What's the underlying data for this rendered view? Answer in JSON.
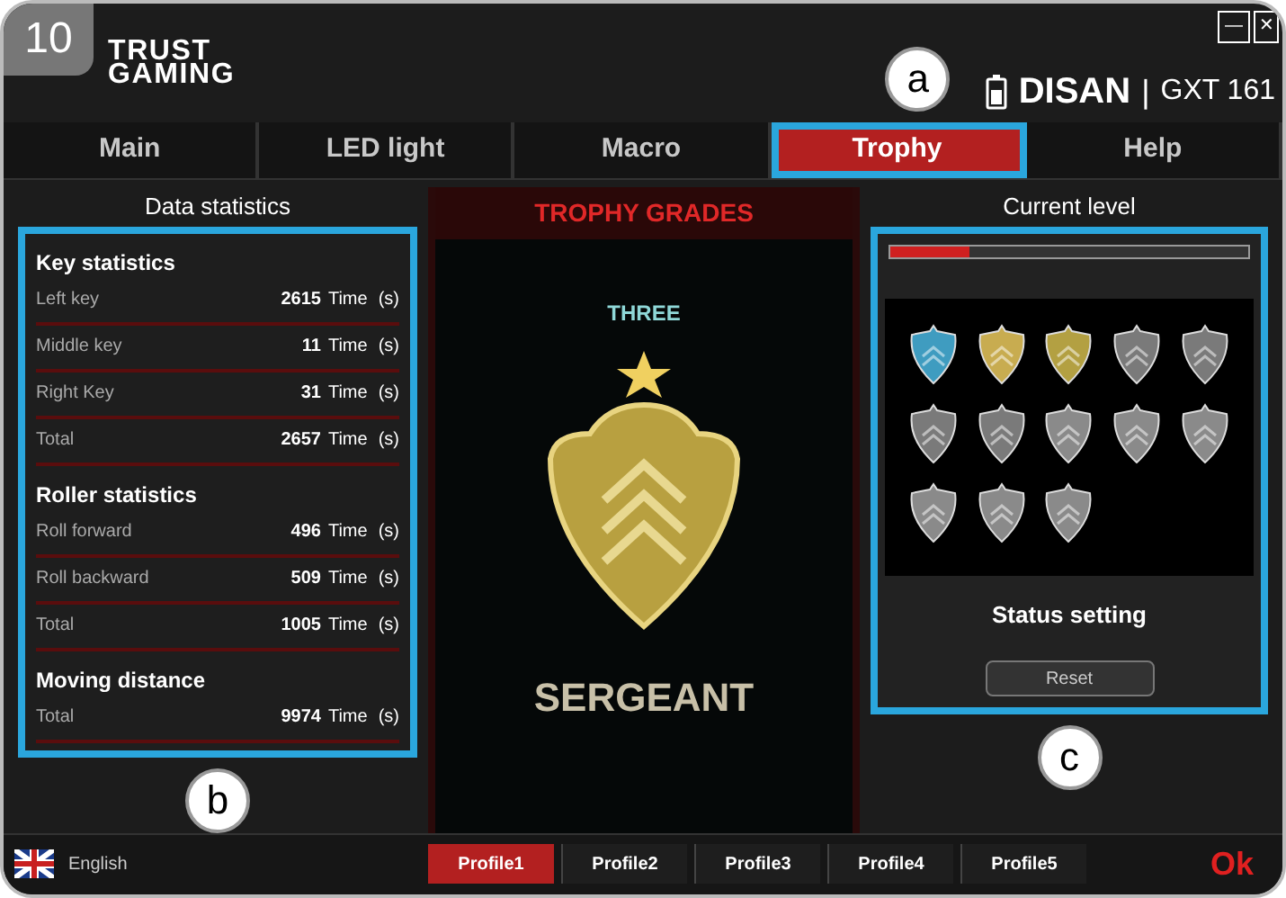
{
  "page_badge": "10",
  "logo": {
    "line_1": "TRUST",
    "line_2": "GAMING"
  },
  "device": {
    "name": "DISAN",
    "separator": "|",
    "model": "GXT 161"
  },
  "window_controls": {
    "minimize": "—",
    "close": "✕"
  },
  "tabs": [
    {
      "label": "Main",
      "selected": false,
      "highlighted": false
    },
    {
      "label": "LED light",
      "selected": false,
      "highlighted": false
    },
    {
      "label": "Macro",
      "selected": false,
      "highlighted": false
    },
    {
      "label": "Trophy",
      "selected": true,
      "highlighted": true
    },
    {
      "label": "Help",
      "selected": false,
      "highlighted": false
    }
  ],
  "callouts": [
    "a",
    "b",
    "c"
  ],
  "stats": {
    "title": "Data statistics",
    "highlighted": true,
    "groups": [
      {
        "title": "Key statistics",
        "rows": [
          {
            "label": "Left key",
            "value": "2615",
            "unit": "Time",
            "suffix": "(s)"
          },
          {
            "label": "Middle key",
            "value": "11",
            "unit": "Time",
            "suffix": "(s)"
          },
          {
            "label": "Right Key",
            "value": "31",
            "unit": "Time",
            "suffix": "(s)"
          },
          {
            "label": "Total",
            "value": "2657",
            "unit": "Time",
            "suffix": "(s)"
          }
        ]
      },
      {
        "title": "Roller statistics",
        "rows": [
          {
            "label": "Roll forward",
            "value": "496",
            "unit": "Time",
            "suffix": "(s)"
          },
          {
            "label": "Roll backward",
            "value": "509",
            "unit": "Time",
            "suffix": "(s)"
          },
          {
            "label": "Total",
            "value": "1005",
            "unit": "Time",
            "suffix": "(s)"
          }
        ]
      },
      {
        "title": "Moving distance",
        "rows": [
          {
            "label": "Total",
            "value": "9974",
            "unit": "Time",
            "suffix": "(s)"
          }
        ]
      }
    ]
  },
  "trophy": {
    "title": "TROPHY GRADES",
    "grade": "THREE",
    "rank": "SERGEANT"
  },
  "level": {
    "title": "Current level",
    "highlighted": true,
    "level": 0.22,
    "badges": [
      {
        "color": "#3f9cc0"
      },
      {
        "color": "#c8ac50"
      },
      {
        "color": "#b3a042"
      },
      {
        "color": "#7a7a7a"
      },
      {
        "color": "#7a7a7a"
      },
      {
        "color": "#7a7a7a"
      },
      {
        "color": "#7a7a7a"
      },
      {
        "color": "#8a8a8a"
      },
      {
        "color": "#8a8a8a"
      },
      {
        "color": "#8a8a8a"
      },
      {
        "color": "#8a8a8a"
      },
      {
        "color": "#8a8a8a"
      },
      {
        "color": "#8a8a8a"
      }
    ],
    "status_title": "Status setting",
    "reset_button": "Reset"
  },
  "footer": {
    "language": "English",
    "profiles": [
      {
        "label": "Profile1",
        "selected": true
      },
      {
        "label": "Profile2",
        "selected": false
      },
      {
        "label": "Profile3",
        "selected": false
      },
      {
        "label": "Profile4",
        "selected": false
      },
      {
        "label": "Profile5",
        "selected": false
      }
    ],
    "ok_button": "Ok"
  }
}
